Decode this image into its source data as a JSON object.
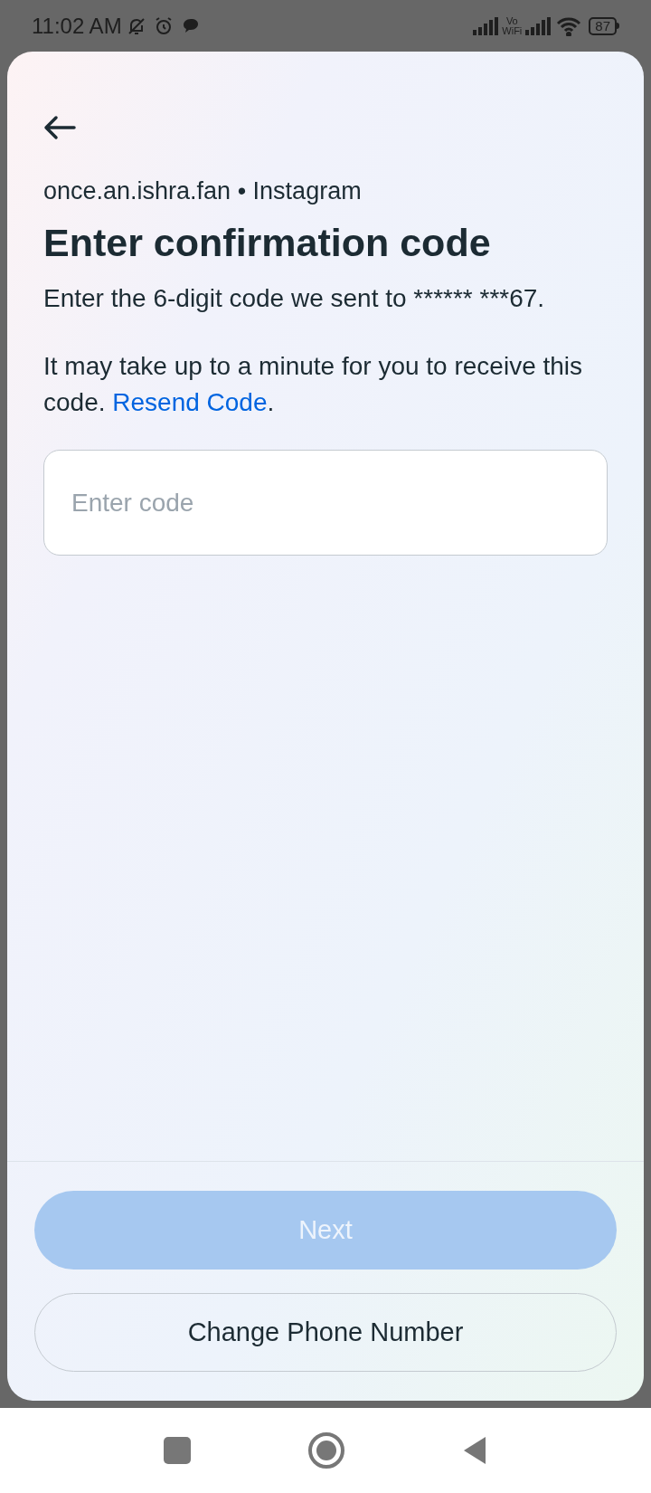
{
  "status_bar": {
    "time": "11:02 AM",
    "volte_label": "Vo WiFi",
    "battery": "87"
  },
  "header": {
    "account": "once.an.ishra.fan • Instagram",
    "title": "Enter confirmation code"
  },
  "instructions": {
    "line": "Enter the 6-digit code we sent to ****** ***67.",
    "note": "It may take up to a minute for you to receive this code.",
    "link": "Resend Code",
    "trail": "."
  },
  "code_field": {
    "placeholder": "Enter code"
  },
  "buttons": [
    {
      "kind": "primary",
      "label": "Next",
      "disabled": true
    },
    {
      "kind": "outline",
      "label": "Change Phone Number",
      "disabled": false
    }
  ]
}
